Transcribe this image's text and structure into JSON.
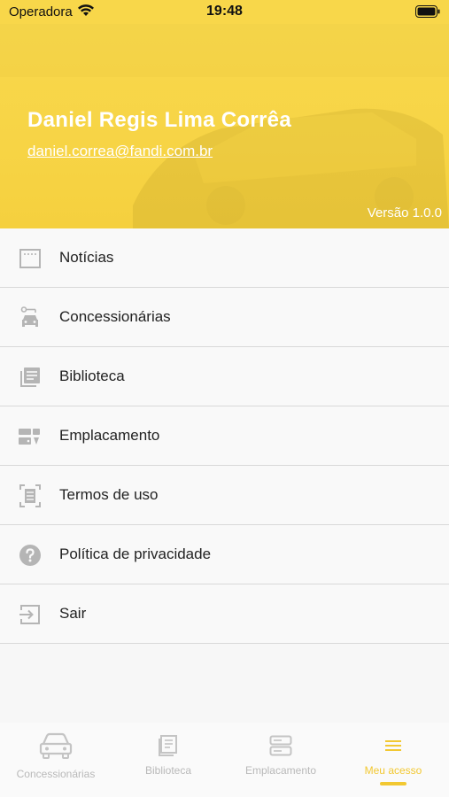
{
  "status_bar": {
    "carrier": "Operadora",
    "time": "19:48"
  },
  "profile": {
    "name": "Daniel Regis Lima Corrêa",
    "email": "daniel.correa@fandi.com.br",
    "version": "Versão 1.0.0"
  },
  "menu": {
    "items": [
      {
        "label": "Notícias",
        "icon": "news-icon"
      },
      {
        "label": "Concessionárias",
        "icon": "dealership-icon"
      },
      {
        "label": "Biblioteca",
        "icon": "library-icon"
      },
      {
        "label": "Emplacamento",
        "icon": "license-plate-icon"
      },
      {
        "label": "Termos de uso",
        "icon": "terms-icon"
      },
      {
        "label": "Política de privacidade",
        "icon": "help-icon"
      },
      {
        "label": "Sair",
        "icon": "logout-icon"
      }
    ]
  },
  "tab_bar": {
    "tabs": [
      {
        "label": "Concessionárias",
        "icon": "car-icon"
      },
      {
        "label": "Biblioteca",
        "icon": "book-icon"
      },
      {
        "label": "Emplacamento",
        "icon": "server-icon"
      },
      {
        "label": "Meu acesso",
        "icon": "menu-icon"
      }
    ],
    "active_index": 3
  },
  "colors": {
    "brand_yellow": "#f8d74a",
    "active_tab": "#f2c832",
    "inactive_tab": "#b9b9b9"
  }
}
